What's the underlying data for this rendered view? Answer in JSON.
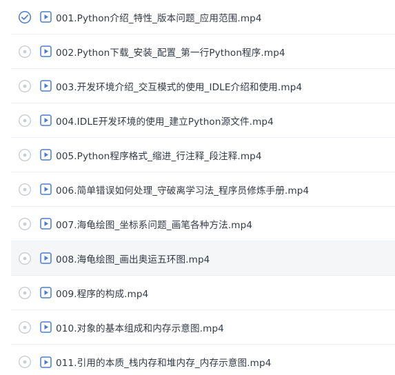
{
  "lessons": [
    {
      "title": "001.Python介绍_特性_版本问题_应用范围.mp4",
      "status": "check-circle-icon"
    },
    {
      "title": "002.Python下载_安装_配置_第一行Python程序.mp4",
      "status": "radio-dot-icon"
    },
    {
      "title": "003.开发环境介绍_交互模式的使用_IDLE介绍和使用.mp4",
      "status": "radio-dot-icon"
    },
    {
      "title": "004.IDLE开发环境的使用_建立Python源文件.mp4",
      "status": "radio-dot-icon"
    },
    {
      "title": "005.Python程序格式_缩进_行注释_段注释.mp4",
      "status": "radio-dot-icon"
    },
    {
      "title": "006.简单错误如何处理_守破离学习法_程序员修炼手册.mp4",
      "status": "radio-dot-icon"
    },
    {
      "title": "007.海龟绘图_坐标系问题_画笔各种方法.mp4",
      "status": "radio-dot-icon"
    },
    {
      "title": "008.海龟绘图_画出奥运五环图.mp4",
      "status": "radio-dot-icon"
    },
    {
      "title": "009.程序的构成.mp4",
      "status": "radio-dot-icon"
    },
    {
      "title": "010.对象的基本组成和内存示意图.mp4",
      "status": "radio-dot-icon"
    },
    {
      "title": "011.引用的本质_栈内存和堆内存_内存示意图.mp4",
      "status": "radio-dot-icon"
    }
  ],
  "colors": {
    "accent": "#4a7bd3",
    "status_gray": "#c9cdd4",
    "text": "#333a45",
    "active_row_bg": "#f4f6f8"
  }
}
